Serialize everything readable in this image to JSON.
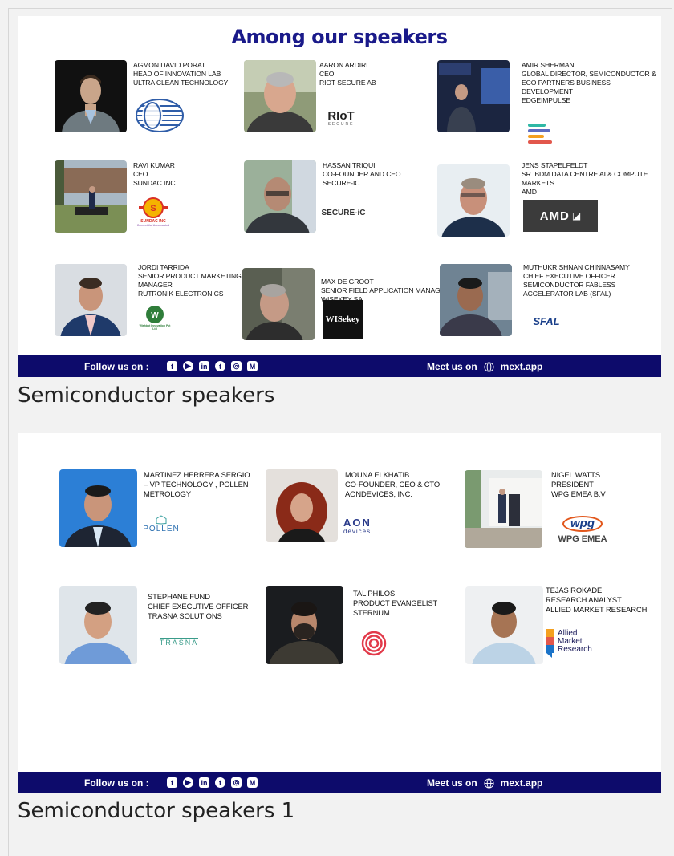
{
  "panel1": {
    "heading": "Among our speakers",
    "speakers": [
      {
        "lines": [
          "AGMON DAVID PORAT",
          "HEAD OF INNOVATION LAB",
          "ULTRA CLEAN TECHNOLOGY"
        ]
      },
      {
        "lines": [
          "AARON ARDIRI",
          "CEO",
          "RIOT SECURE AB"
        ]
      },
      {
        "lines": [
          "AMIR SHERMAN",
          "GLOBAL DIRECTOR, SEMICONDUCTOR &",
          "ECO PARTNERS BUSINESS",
          "DEVELOPMENT",
          "EDGEIMPULSE"
        ]
      },
      {
        "lines": [
          "RAVI KUMAR",
          "CEO",
          "SUNDAC INC"
        ]
      },
      {
        "lines": [
          "HASSAN TRIQUI",
          "CO-FOUNDER AND CEO",
          "SECURE-IC"
        ]
      },
      {
        "lines": [
          "JENS STAPELFELDT",
          "SR. BDM DATA CENTRE AI & COMPUTE",
          "MARKETS",
          "AMD"
        ]
      },
      {
        "lines": [
          "JORDI TARRIDA",
          "SENIOR PRODUCT MARKETING",
          "MANAGER",
          "RUTRONIK ELECTRONICS"
        ]
      },
      {
        "lines": [
          "MAX DE GROOT",
          "SENIOR FIELD APPLICATION MANAGER",
          "WISEKEY SA"
        ]
      },
      {
        "lines": [
          "MUTHUKRISHNAN CHINNASAMY",
          "CHIEF EXECUTIVE OFFICER",
          "SEMICONDUCTOR FABLESS",
          "ACCELERATOR LAB (SFAL)"
        ]
      }
    ],
    "logos": {
      "riot": "RIoT",
      "riot_sub": "SECURE",
      "sundac": "SUNDAC INC",
      "sundac_sub": "Connect the Unconnected",
      "secureic": "SECURE-iC",
      "amd": "AMD",
      "wishbot": "Wishbot Innovation Pvt Ltd",
      "wisekey": "WISekey",
      "sfal": "SFAL"
    }
  },
  "panel2": {
    "speakers": [
      {
        "lines": [
          "MARTINEZ HERRERA SERGIO",
          "– VP TECHNOLOGY , POLLEN",
          "METROLOGY"
        ]
      },
      {
        "lines": [
          "MOUNA ELKHATIB",
          "CO-FOUNDER, CEO & CTO",
          "AONDEVICES, INC."
        ]
      },
      {
        "lines": [
          "NIGEL WATTS",
          "PRESIDENT",
          "WPG EMEA B.V"
        ]
      },
      {
        "lines": [
          "STEPHANE FUND",
          "CHIEF EXECUTIVE OFFICER",
          "TRASNA SOLUTIONS"
        ]
      },
      {
        "lines": [
          "TAL PHILOS",
          "PRODUCT EVANGELIST",
          "STERNUM"
        ]
      },
      {
        "lines": [
          "TEJAS ROKADE",
          "RESEARCH ANALYST",
          "ALLIED MARKET RESEARCH"
        ]
      }
    ],
    "logos": {
      "pollen": "POLLEN",
      "aon": "AON",
      "aon_sub": "devices",
      "wpg": "wpg",
      "wpg_sub": "WPG EMEA",
      "trasna": "TRASNA",
      "allied1": "Allied",
      "allied2": "Market",
      "allied3": "Research"
    }
  },
  "footer": {
    "follow_label": "Follow us on :",
    "socials": [
      {
        "icon": "facebook-icon",
        "glyph": "f"
      },
      {
        "icon": "youtube-icon",
        "glyph": "▶"
      },
      {
        "icon": "linkedin-icon",
        "glyph": "in"
      },
      {
        "icon": "twitter-icon",
        "glyph": "t"
      },
      {
        "icon": "instagram-icon",
        "glyph": "◎"
      },
      {
        "icon": "medium-icon",
        "glyph": "M"
      }
    ],
    "meet_label": "Meet us on",
    "meet_link": "mext.app"
  },
  "captions": {
    "first": "Semiconductor speakers",
    "second": "Semiconductor speakers 1"
  },
  "colors": {
    "heading": "#1a1a8a",
    "footer_bg": "#0d0b6b",
    "amd_bg": "#3b3b3b"
  }
}
